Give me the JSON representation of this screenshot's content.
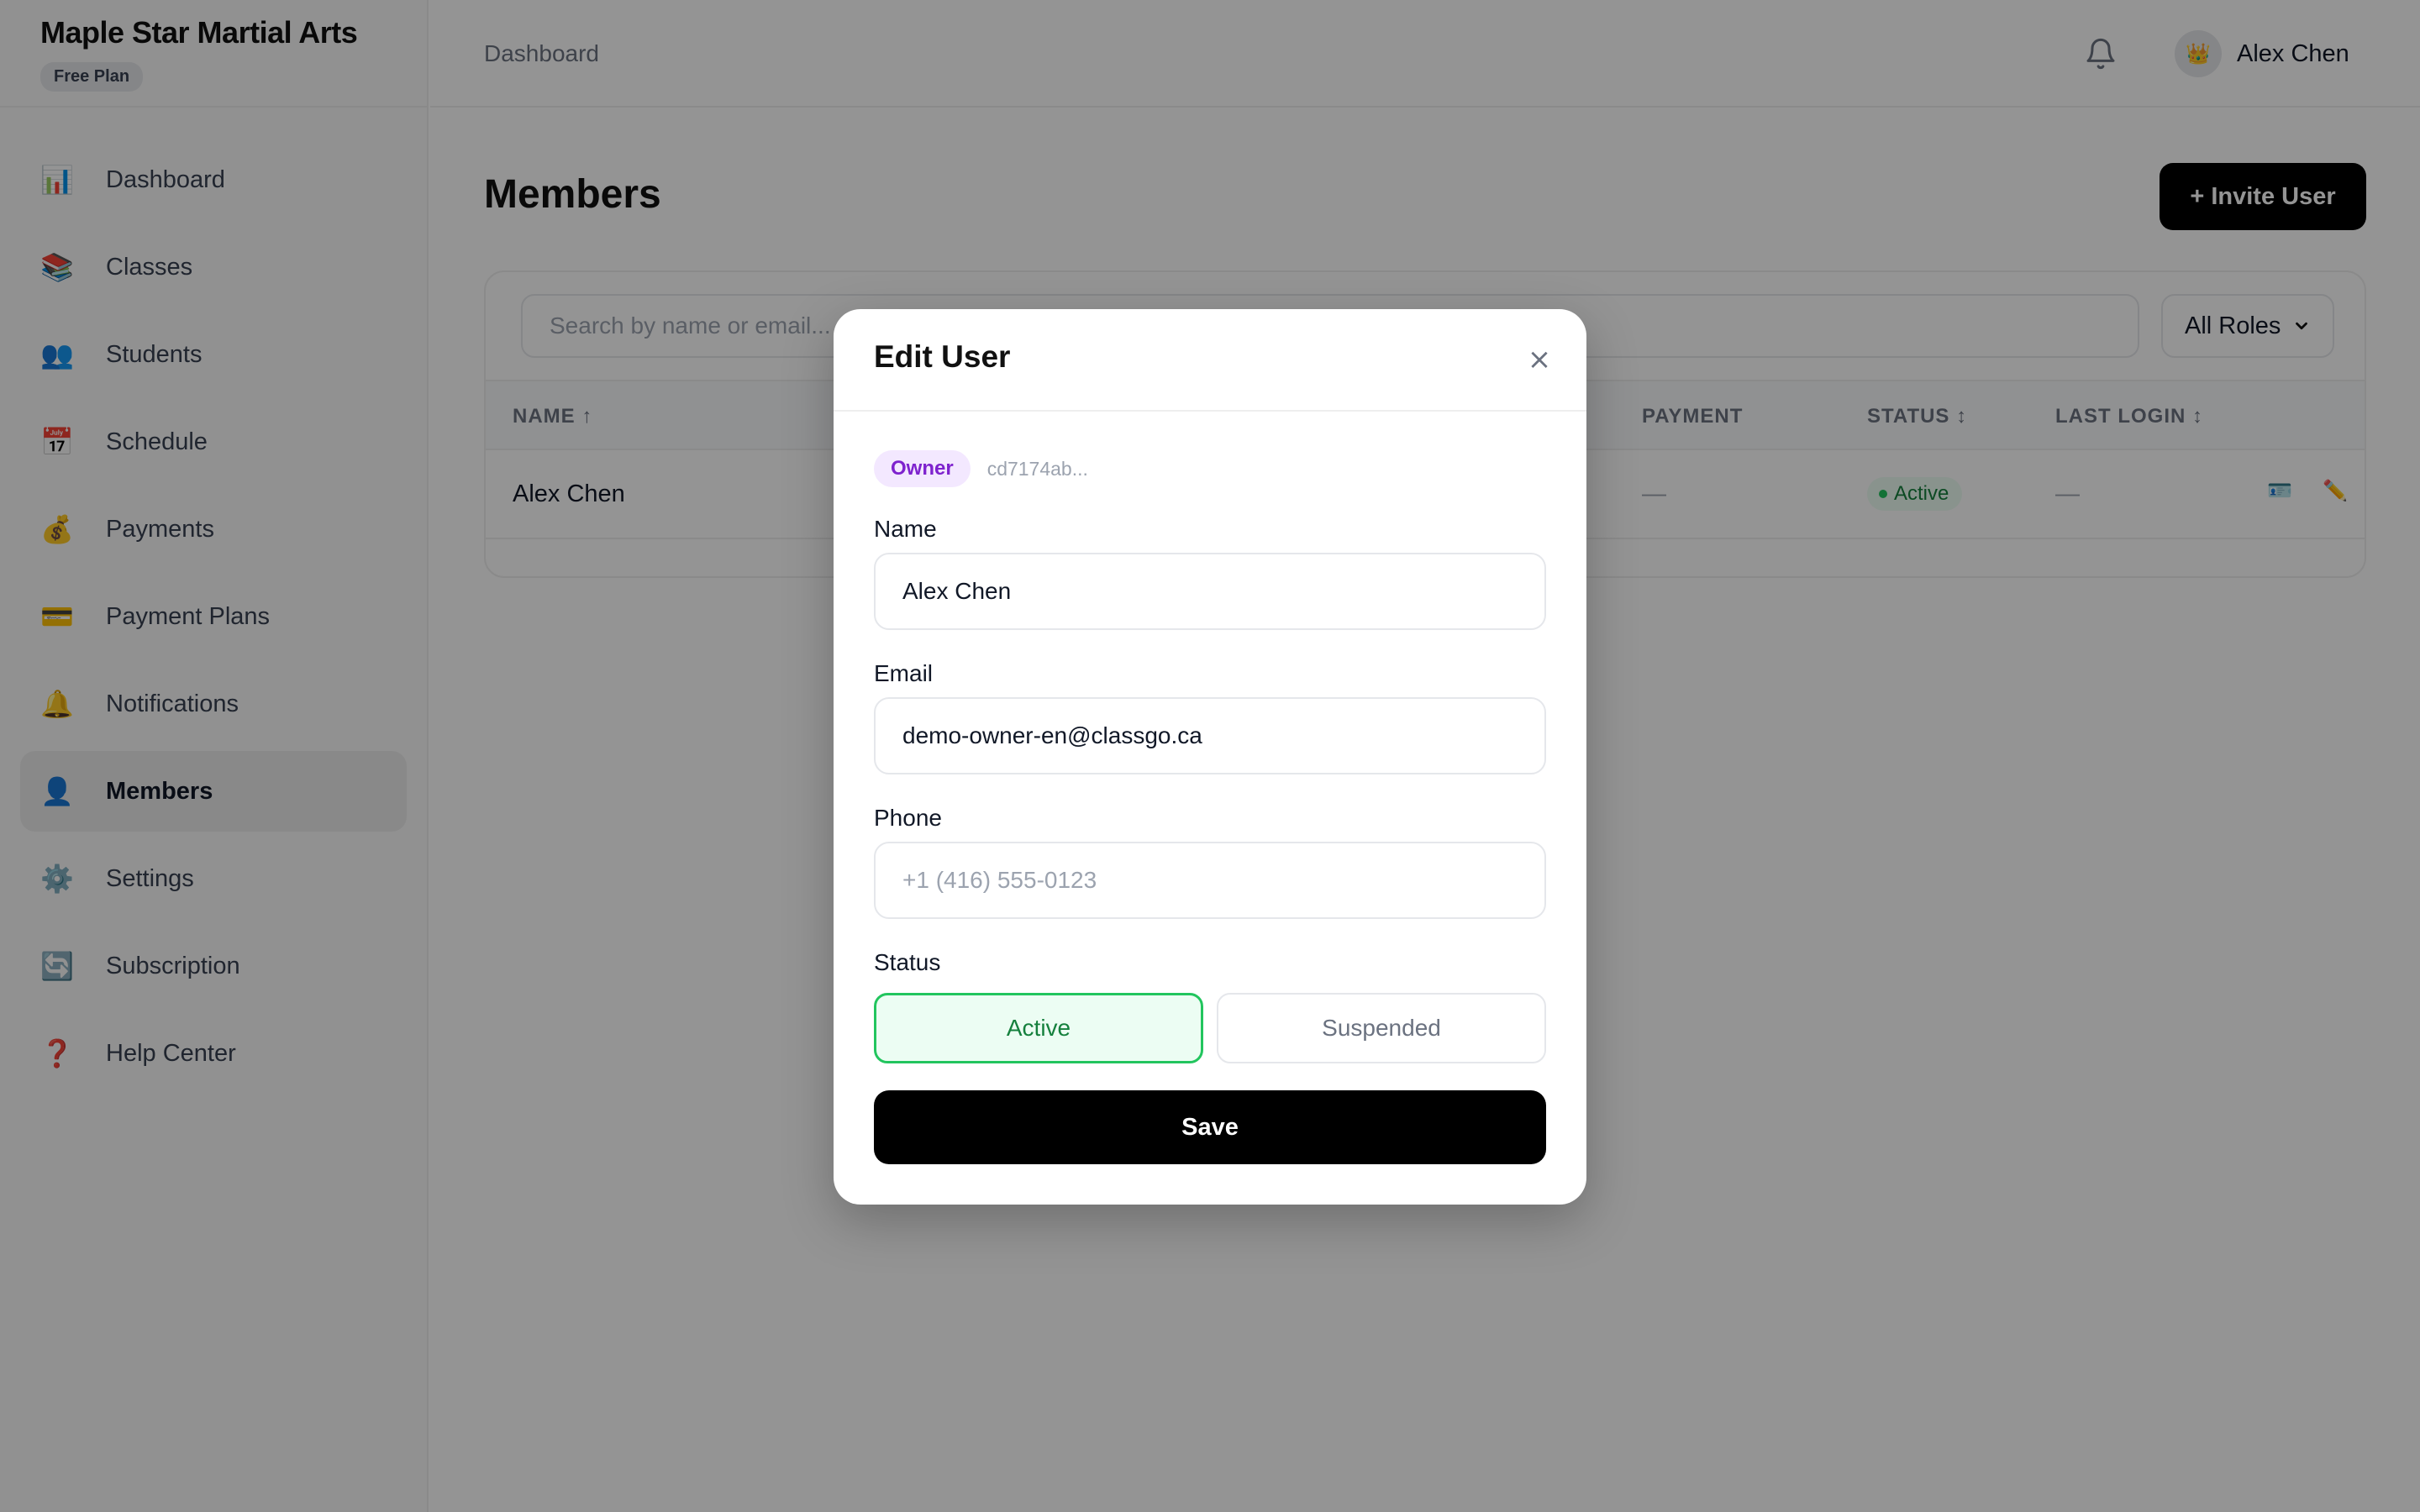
{
  "sidebar": {
    "brand": "Maple Star Martial Arts",
    "plan": "Free Plan",
    "items": [
      {
        "label": "Dashboard",
        "icon": "📊"
      },
      {
        "label": "Classes",
        "icon": "📚"
      },
      {
        "label": "Students",
        "icon": "👥"
      },
      {
        "label": "Schedule",
        "icon": "📅"
      },
      {
        "label": "Payments",
        "icon": "💰"
      },
      {
        "label": "Payment Plans",
        "icon": "💳"
      },
      {
        "label": "Notifications",
        "icon": "🔔"
      },
      {
        "label": "Members",
        "icon": "👤"
      },
      {
        "label": "Settings",
        "icon": "⚙️"
      },
      {
        "label": "Subscription",
        "icon": "🔄"
      },
      {
        "label": "Help Center",
        "icon": "❓"
      }
    ],
    "active": "Members"
  },
  "header": {
    "breadcrumb": "Dashboard",
    "user_name": "Alex Chen",
    "avatar_icon": "👑"
  },
  "main": {
    "title": "Members",
    "invite_label": "+ Invite User",
    "search_placeholder": "Search by name or email...",
    "role_filter": "All Roles",
    "columns": {
      "name": "NAME ↑",
      "payment": "PAYMENT",
      "status": "STATUS ↕",
      "last_login": "LAST LOGIN ↕"
    },
    "rows": [
      {
        "name": "Alex Chen",
        "payment": "—",
        "status": "Active",
        "last_login": "—"
      }
    ]
  },
  "modal": {
    "title": "Edit User",
    "close_glyph": "×",
    "role": "Owner",
    "user_id": "cd7174ab...",
    "name_label": "Name",
    "name_value": "Alex Chen",
    "email_label": "Email",
    "email_value": "demo-owner-en@classgo.ca",
    "phone_label": "Phone",
    "phone_placeholder": "+1 (416) 555-0123",
    "status_label": "Status",
    "status_options": [
      "Active",
      "Suspended"
    ],
    "status_selected": "Active",
    "save_label": "Save"
  },
  "colors": {
    "accent": "#000000",
    "active_green": "#22c55e",
    "owner_purple": "#7e22ce"
  }
}
